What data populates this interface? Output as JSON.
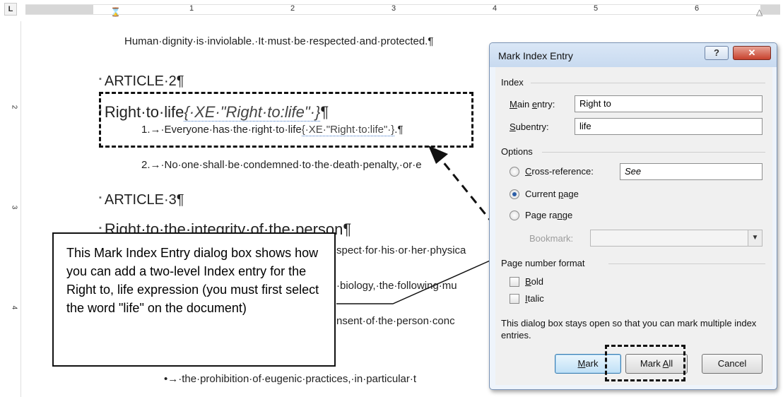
{
  "ruler": {
    "corner": "L",
    "numbers": [
      "1",
      "2",
      "3",
      "4",
      "5",
      "6"
    ],
    "vnumbers": [
      "2",
      "3",
      "4"
    ]
  },
  "document": {
    "line1": "Human·dignity·is·inviolable.·It·must·be·respected·and·protected.¶",
    "article2": "ARTICLE·2¶",
    "right_to_life_title": "Right·to·life",
    "right_to_life_field": "{·XE·\"Right·to:life\"·}",
    "title_pilcrow": "¶",
    "item1_text": "1.→·Everyone·has·the·right·to·life",
    "item1_field": "{·XE·\"Right·to:life\"·}",
    "item1_end": ".¶",
    "item2": "2.→·No·one·shall·be·condemned·to·the·death·penalty,·or·e",
    "article3": "ARTICLE·3¶",
    "integrity_title": "Right·to·the·integrity·of·the·person¶",
    "line_respect": "spect·for·his·or·her·physica",
    "line_biology": "·biology,·the·following·mu",
    "line_consent": "nsent·of·the·person·conc",
    "bullet_line": "•→·the·prohibition·of·eugenic·practices,·in·particular·t"
  },
  "callout": {
    "text": "This Mark Index Entry dialog box shows how you can add a two-level Index entry for the Right to, life expression (you must first select  the word \"life\" on the document)"
  },
  "dialog": {
    "title": "Mark Index Entry",
    "help_label": "?",
    "close_label": "✕",
    "index_section": "Index",
    "main_entry_label": "Main entry:",
    "main_entry_value": "Right to",
    "subentry_label": "Subentry:",
    "subentry_value": "life",
    "options_section": "Options",
    "cross_reference_label": "Cross-reference:",
    "cross_reference_value": "See",
    "current_page_label": "Current page",
    "current_page_selected": true,
    "page_range_label": "Page range",
    "bookmark_label": "Bookmark:",
    "bookmark_value": "",
    "page_number_format_section": "Page number format",
    "bold_label": "Bold",
    "italic_label": "Italic",
    "note": "This dialog box stays open so that you can mark multiple index entries.",
    "mark_button": "Mark",
    "mark_all_button": "Mark All",
    "cancel_button": "Cancel"
  },
  "colors": {
    "dialog_bg": "#f0f0f0",
    "titlebar": "#c8daf0",
    "close_red": "#c7412d",
    "radio_selected": "#2d5fa8"
  }
}
